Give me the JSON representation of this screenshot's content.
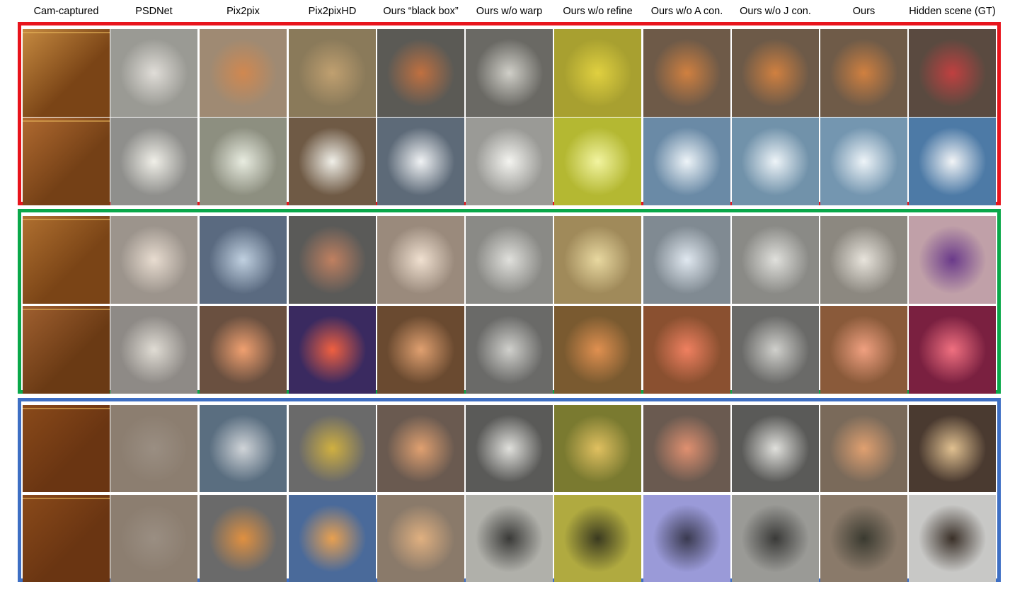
{
  "columns": [
    "Cam-captured",
    "PSDNet",
    "Pix2pix",
    "Pix2pixHD",
    "Ours “black box”",
    "Ours w/o warp",
    "Ours w/o refine",
    "Ours w/o A con.",
    "Ours w/o J con.",
    "Ours",
    "Hidden scene (GT)"
  ],
  "groups": [
    {
      "border_color": "#e8141c",
      "rows": [
        [
          "#7a4416",
          "#9a9a94",
          "#9f8a73",
          "#8a7a5a",
          "#5b5a55",
          "#6a6964",
          "#a8a030",
          "#6e5a48",
          "#6d5a48",
          "#6f5b48",
          "#5a4a40"
        ],
        [
          "#744016",
          "#8f8f8c",
          "#8d8f80",
          "#6f5a45",
          "#5d6a78",
          "#9a9a96",
          "#b4b832",
          "#6a8aa6",
          "#7192aa",
          "#7496b0",
          "#4d7aa6"
        ]
      ],
      "accents": [
        [
          "#c68a40",
          "#e0ddd8",
          "#d08850",
          "#c0a070",
          "#c07040",
          "#d0cfc8",
          "#e0d040",
          "#d08040",
          "#d08040",
          "#d08040",
          "#c04040"
        ],
        [
          "#b06a30",
          "#f0efe8",
          "#e8ece0",
          "#f0efe8",
          "#f0f2f4",
          "#f4f4f0",
          "#f2f4a0",
          "#eef4f8",
          "#eef4f8",
          "#eef4f8",
          "#f2f4f6"
        ]
      ]
    },
    {
      "border_color": "#0aa84a",
      "rows": [
        [
          "#7a4416",
          "#9c948c",
          "#5a6a80",
          "#5a5a58",
          "#9a8a7c",
          "#8a8a86",
          "#a08a5a",
          "#808a92",
          "#8a8a86",
          "#8c8880",
          "#c0a0a8"
        ],
        [
          "#6a3a14",
          "#8e8a86",
          "#6a5040",
          "#3a2a60",
          "#6a4a30",
          "#6a6a68",
          "#7a5a30",
          "#8a5030",
          "#6a6a68",
          "#8a5a3a",
          "#7a2040"
        ]
      ],
      "accents": [
        [
          "#b07030",
          "#e8dcd0",
          "#c0d0e0",
          "#c08060",
          "#f0e0d0",
          "#e0e0dc",
          "#e8d8a0",
          "#e0e8f0",
          "#e0e0dc",
          "#e8e4dc",
          "#6a3a8a"
        ],
        [
          "#a06030",
          "#e0dcd4",
          "#f0a070",
          "#f06040",
          "#e0a070",
          "#d0d0cc",
          "#e09050",
          "#f08060",
          "#d0d0cc",
          "#f0a080",
          "#f07080"
        ]
      ]
    },
    {
      "border_color": "#3e6fc4",
      "rows": [
        [
          "#6a3512",
          "#8c7e70",
          "#5a6e80",
          "#6a6a6a",
          "#6a5a50",
          "#5a5a58",
          "#7a7a30",
          "#6a5a50",
          "#5a5a58",
          "#7a6a5a",
          "#4a3a30"
        ],
        [
          "#6a3512",
          "#8c7e70",
          "#6a6a6a",
          "#4a6a9a",
          "#8a7a6a",
          "#b0b0aa",
          "#b0aa40",
          "#9a9ad8",
          "#9a9a96",
          "#8a7a6a",
          "#c8c8c6"
        ]
      ],
      "accents": [
        [
          "#8a4a1a",
          "#9a8e82",
          "#d0d4d8",
          "#d0b040",
          "#e0a070",
          "#e0e0dc",
          "#e0c060",
          "#e09070",
          "#e0e0dc",
          "#e0a070",
          "#e0c090"
        ],
        [
          "#8a4a1a",
          "#9a8e82",
          "#e09040",
          "#e8a050",
          "#e0b080",
          "#3a3a38",
          "#3a3a20",
          "#3a3a50",
          "#3a3a38",
          "#3a3a30",
          "#3a3028"
        ]
      ]
    }
  ]
}
